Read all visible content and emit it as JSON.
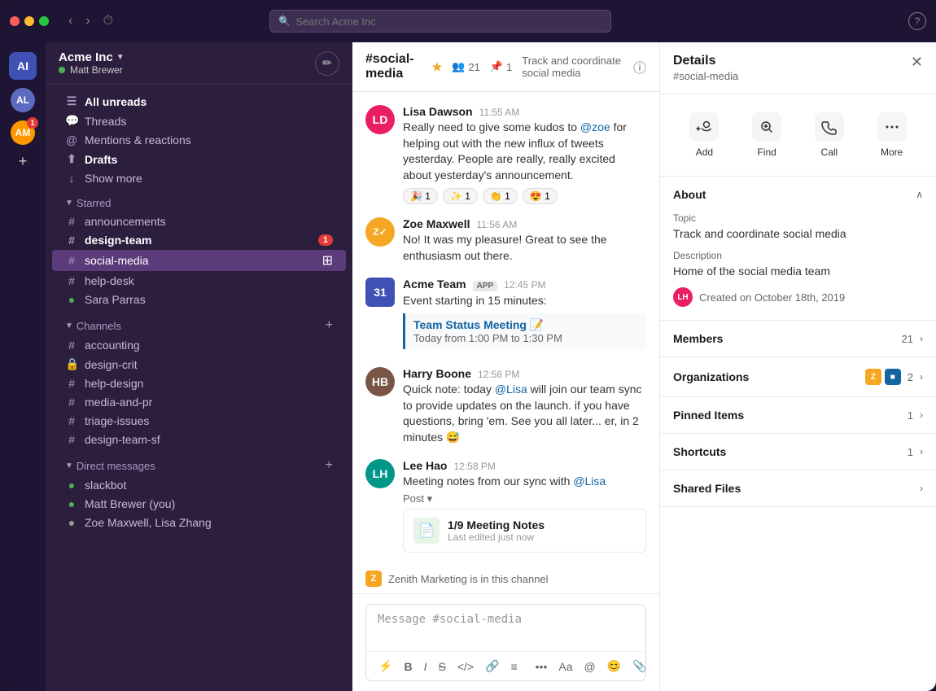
{
  "titlebar": {
    "search_placeholder": "Search Acme Inc"
  },
  "workspace": {
    "name": "Acme Inc",
    "user": "Matt Brewer",
    "initials": "AI"
  },
  "avatars": [
    {
      "initials": "AL",
      "color": "#5c6bc0"
    },
    {
      "initials": "AM",
      "color": "#ff9800",
      "badge": "1"
    }
  ],
  "nav": {
    "all_unreads": "All unreads",
    "threads": "Threads",
    "mentions": "Mentions & reactions",
    "drafts": "Drafts",
    "show_more": "Show more"
  },
  "starred": {
    "label": "Starred",
    "items": [
      {
        "name": "announcements",
        "type": "channel"
      },
      {
        "name": "design-team",
        "type": "channel",
        "bold": true,
        "badge": "1"
      },
      {
        "name": "social-media",
        "type": "channel",
        "active": true
      },
      {
        "name": "help-desk",
        "type": "channel"
      },
      {
        "name": "Sara Parras",
        "type": "dm"
      }
    ]
  },
  "channels": {
    "label": "Channels",
    "items": [
      {
        "name": "accounting",
        "type": "channel"
      },
      {
        "name": "design-crit",
        "type": "locked"
      },
      {
        "name": "help-design",
        "type": "channel"
      },
      {
        "name": "media-and-pr",
        "type": "channel"
      },
      {
        "name": "triage-issues",
        "type": "channel"
      },
      {
        "name": "design-team-sf",
        "type": "channel"
      }
    ]
  },
  "direct_messages": {
    "label": "Direct messages",
    "items": [
      {
        "name": "slackbot",
        "online": true
      },
      {
        "name": "Matt Brewer (you)",
        "online": true
      },
      {
        "name": "Zoe Maxwell, Lisa Zhang",
        "online": false
      }
    ]
  },
  "channel": {
    "name": "#social-media",
    "members": "21",
    "pinned": "1",
    "description": "Track and coordinate social media"
  },
  "messages": [
    {
      "id": "msg1",
      "author": "Lisa Dawson",
      "time": "11:55 AM",
      "avatar_color": "#e91e63",
      "avatar_initials": "LD",
      "text": "Really need to give some kudos to @zoe for helping out with the new influx of tweets yesterday. People are really, really excited about yesterday's announcement.",
      "reactions": [
        {
          "emoji": "🎉",
          "count": "1"
        },
        {
          "emoji": "✨",
          "count": "1"
        },
        {
          "emoji": "👏",
          "count": "1"
        },
        {
          "emoji": "😍",
          "count": "1"
        }
      ]
    },
    {
      "id": "msg2",
      "author": "Zoe Maxwell",
      "time": "11:56 AM",
      "avatar_color": "#f5a623",
      "avatar_initials": "ZM",
      "text": "No! It was my pleasure! Great to see the enthusiasm out there."
    },
    {
      "id": "msg3",
      "author": "Acme Team",
      "time": "12:45 PM",
      "avatar_color": "#3f51b5",
      "avatar_initials": "31",
      "badge": "APP",
      "text": "Event starting in 15 minutes:",
      "quote": {
        "title": "Team Status Meeting 📝",
        "subtitle": "Today from 1:00 PM to 1:30 PM"
      }
    },
    {
      "id": "msg4",
      "author": "Harry Boone",
      "time": "12:58 PM",
      "avatar_color": "#795548",
      "avatar_initials": "HB",
      "text": "Quick note: today @Lisa will join our team sync to provide updates on the launch. if you have questions, bring 'em. See you all later... er, in 2 minutes 😅"
    },
    {
      "id": "msg5",
      "author": "Lee Hao",
      "time": "12:58 PM",
      "avatar_color": "#009688",
      "avatar_initials": "LH",
      "text": "Meeting notes from our sync with @Lisa",
      "post_label": "Post",
      "post": {
        "title": "1/9 Meeting Notes",
        "subtitle": "Last edited just now"
      }
    }
  ],
  "zenith_notice": "Zenith Marketing is in this channel",
  "message_placeholder": "Message #social-media",
  "details": {
    "title": "Details",
    "subtitle": "#social-media",
    "actions": [
      {
        "label": "Add",
        "icon": "👤+"
      },
      {
        "label": "Find",
        "icon": "🔍"
      },
      {
        "label": "Call",
        "icon": "📞"
      },
      {
        "label": "More",
        "icon": "•••"
      }
    ],
    "about": {
      "label": "About",
      "topic_label": "Topic",
      "topic_value": "Track and coordinate social media",
      "description_label": "Description",
      "description_value": "Home of the social media team",
      "created": "Created on October 18th, 2019"
    },
    "members": {
      "label": "Members",
      "count": "21"
    },
    "organizations": {
      "label": "Organizations",
      "count": "2"
    },
    "pinned": {
      "label": "Pinned Items",
      "count": "1"
    },
    "shortcuts": {
      "label": "Shortcuts",
      "count": "1"
    },
    "shared_files": {
      "label": "Shared Files"
    }
  }
}
